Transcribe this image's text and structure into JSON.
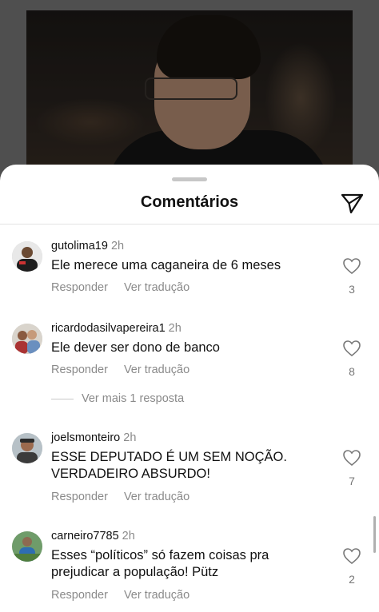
{
  "sheet": {
    "title": "Comentários"
  },
  "icons": {
    "share": "paper-plane-icon",
    "like": "heart-outline-icon"
  },
  "comments": [
    {
      "username": "gutolima19",
      "time": "2h",
      "text": "Ele merece uma caganeira de 6 meses",
      "reply_label": "Responder",
      "translate_label": "Ver tradução",
      "likes": "3"
    },
    {
      "username": "ricardodasilvapereira1",
      "time": "2h",
      "text": "Ele dever ser dono de banco",
      "reply_label": "Responder",
      "translate_label": "Ver tradução",
      "likes": "8",
      "more_replies": "Ver mais 1 resposta"
    },
    {
      "username": "joelsmonteiro",
      "time": "2h",
      "text": "ESSE DEPUTADO É UM SEM NOÇÃO. VERDADEIRO ABSURDO!",
      "reply_label": "Responder",
      "translate_label": "Ver tradução",
      "likes": "7"
    },
    {
      "username": "carneiro7785",
      "time": "2h",
      "text": "Esses “políticos” só fazem coisas pra prejudicar a população! Pütz",
      "reply_label": "Responder",
      "translate_label": "Ver tradução",
      "likes": "2"
    }
  ],
  "colors": {
    "secondary_text": "#8a8a8a",
    "primary_text": "#111111"
  }
}
